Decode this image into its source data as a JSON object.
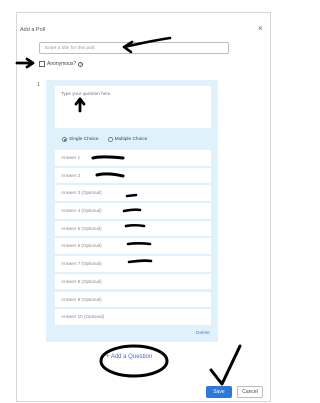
{
  "dialog": {
    "title": "Add a Poll",
    "close_glyph": "×"
  },
  "poll": {
    "title_placeholder": "Enter a title for this poll.",
    "anonymous_label": "Anonymous?",
    "help_glyph": "?"
  },
  "question": {
    "number": "1",
    "placeholder": "Type your question here.",
    "type_options": [
      {
        "label": "Single Choice",
        "selected": true
      },
      {
        "label": "Multiple Choice",
        "selected": false
      }
    ],
    "answers": [
      "Answer 1",
      "Answer 2",
      "Answer 3 (Optional)",
      "Answer 4 (Optional)",
      "Answer 5 (Optional)",
      "Answer 6 (Optional)",
      "Answer 7 (Optional)",
      "Answer 8 (Optional)",
      "Answer 9 (Optional)",
      "Answer 10 (Optional)"
    ],
    "delete_label": "Delete"
  },
  "actions": {
    "add_question_label": "+ Add a Question",
    "save_label": "Save",
    "cancel_label": "Cancel"
  },
  "colors": {
    "panel_background": "#dff1fb",
    "accent_blue": "#2d78d9",
    "link_blue": "#4b68c9",
    "annotation_ink": "#000000"
  }
}
